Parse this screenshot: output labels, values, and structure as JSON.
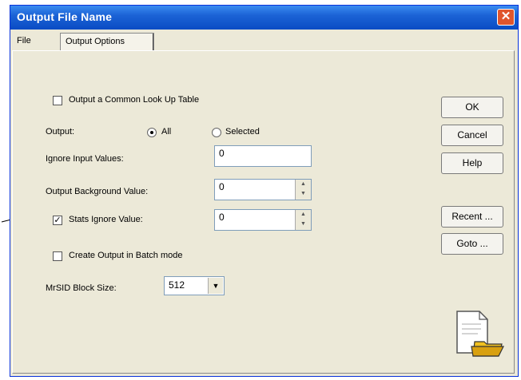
{
  "window": {
    "title": "Output File Name",
    "close_glyph": "✕"
  },
  "tabs": [
    {
      "label": "File"
    },
    {
      "label": "Output Options"
    }
  ],
  "options": {
    "common_lut_label": "Output a Common Look Up Table",
    "output_label": "Output:",
    "radio_all_label": "All",
    "radio_selected_label": "Selected",
    "ignore_input_label": "Ignore Input Values:",
    "ignore_input_value": "0",
    "background_label": "Output Background Value:",
    "background_value": "0",
    "stats_ignore_label": "Stats Ignore Value:",
    "stats_ignore_value": "0",
    "batch_label": "Create Output in Batch mode",
    "mrsid_label": "MrSID Block Size:",
    "mrsid_value": "512"
  },
  "state": {
    "common_lut_checked": false,
    "output_selection": "All",
    "stats_ignore_checked": true,
    "batch_checked": false
  },
  "buttons": {
    "ok": "OK",
    "cancel": "Cancel",
    "help": "Help",
    "recent": "Recent ...",
    "goto": "Goto ..."
  },
  "icons": {
    "file_icon": "document-folder-icon",
    "callout": "callout-arrow"
  }
}
